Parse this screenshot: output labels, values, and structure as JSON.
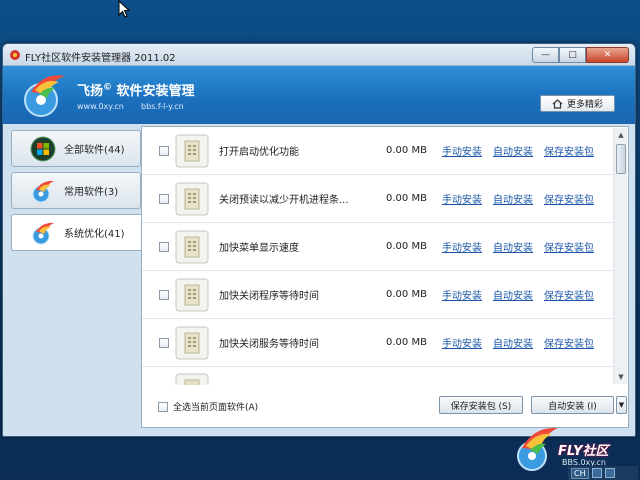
{
  "window": {
    "title": "FLY社区软件安装管理器 2011.02",
    "controls": {
      "minimize": "—",
      "maximize": "□",
      "close": "✕"
    }
  },
  "banner": {
    "brand": "飞扬",
    "brand_mark": "©",
    "brand_suffix": "软件安装管理",
    "site1": "www.0xy.cn",
    "site2": "bbs.f-l-y.cn",
    "more_button": "更多精彩"
  },
  "categories": [
    {
      "label": "全部软件(44)",
      "icon": "windows-logo-icon",
      "active": false
    },
    {
      "label": "常用软件(3)",
      "icon": "fly-logo-icon",
      "active": false
    },
    {
      "label": "系统优化(41)",
      "icon": "fly-logo-icon",
      "active": true
    }
  ],
  "list": {
    "rows": [
      {
        "name": "打开启动优化功能",
        "size": "0.00 MB",
        "manual": "手动安装",
        "auto": "自动安装",
        "save": "保存安装包"
      },
      {
        "name": "关闭预读以减少开机进程条...",
        "size": "0.00 MB",
        "manual": "手动安装",
        "auto": "自动安装",
        "save": "保存安装包"
      },
      {
        "name": "加快菜单显示速度",
        "size": "0.00 MB",
        "manual": "手动安装",
        "auto": "自动安装",
        "save": "保存安装包"
      },
      {
        "name": "加快关闭程序等待时间",
        "size": "0.00 MB",
        "manual": "手动安装",
        "auto": "自动安装",
        "save": "保存安装包"
      },
      {
        "name": "加快关闭服务等待时间",
        "size": "0.00 MB",
        "manual": "手动安装",
        "auto": "自动安装",
        "save": "保存安装包"
      }
    ]
  },
  "footer": {
    "select_all": "全选当前页面软件(A)",
    "save_button": "保存安装包 (S)",
    "auto_button": "自动安装 (I)",
    "dropdown": "▼"
  },
  "desktop": {
    "fly_text": "FLY社区",
    "fly_site": "BBS.0xy.cn",
    "tray_lang": "CH"
  },
  "colors": {
    "banner": "#1a6fbd",
    "link": "#1a56a8"
  }
}
